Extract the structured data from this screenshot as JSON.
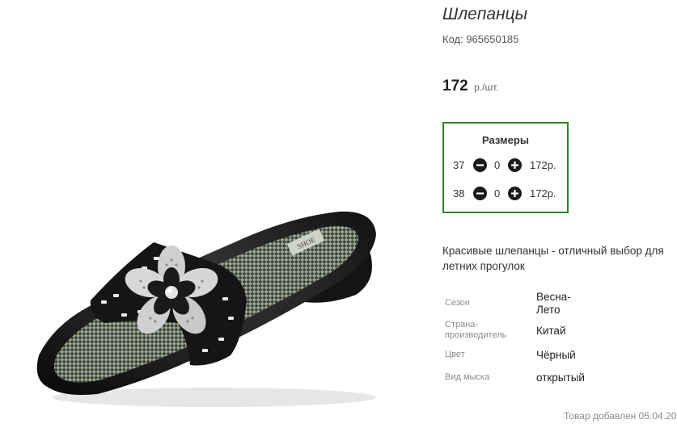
{
  "product": {
    "title": "Шлепанцы",
    "code": "Код: 965650185",
    "price": "172",
    "price_unit": "р./шт.",
    "image_alt": "shoe"
  },
  "sizes": {
    "title": "Размеры",
    "rows": [
      {
        "size": "37",
        "qty": "0",
        "price": "172р."
      },
      {
        "size": "38",
        "qty": "0",
        "price": "172р."
      }
    ]
  },
  "description": "Красивые шлепанцы - отличный выбор для летних прогулок",
  "attributes": [
    {
      "label": "Сезон",
      "value": "Весна-Лето"
    },
    {
      "label": "Страна-производитель",
      "value": "Китай"
    },
    {
      "label": "Цвет",
      "value": "Чёрный"
    },
    {
      "label": "Вид мыска",
      "value": "открытый"
    }
  ],
  "added": "Товар добавлен 05.04.20",
  "colors": {
    "accent_border": "#2a8a22",
    "button": "#1b1b1b"
  }
}
